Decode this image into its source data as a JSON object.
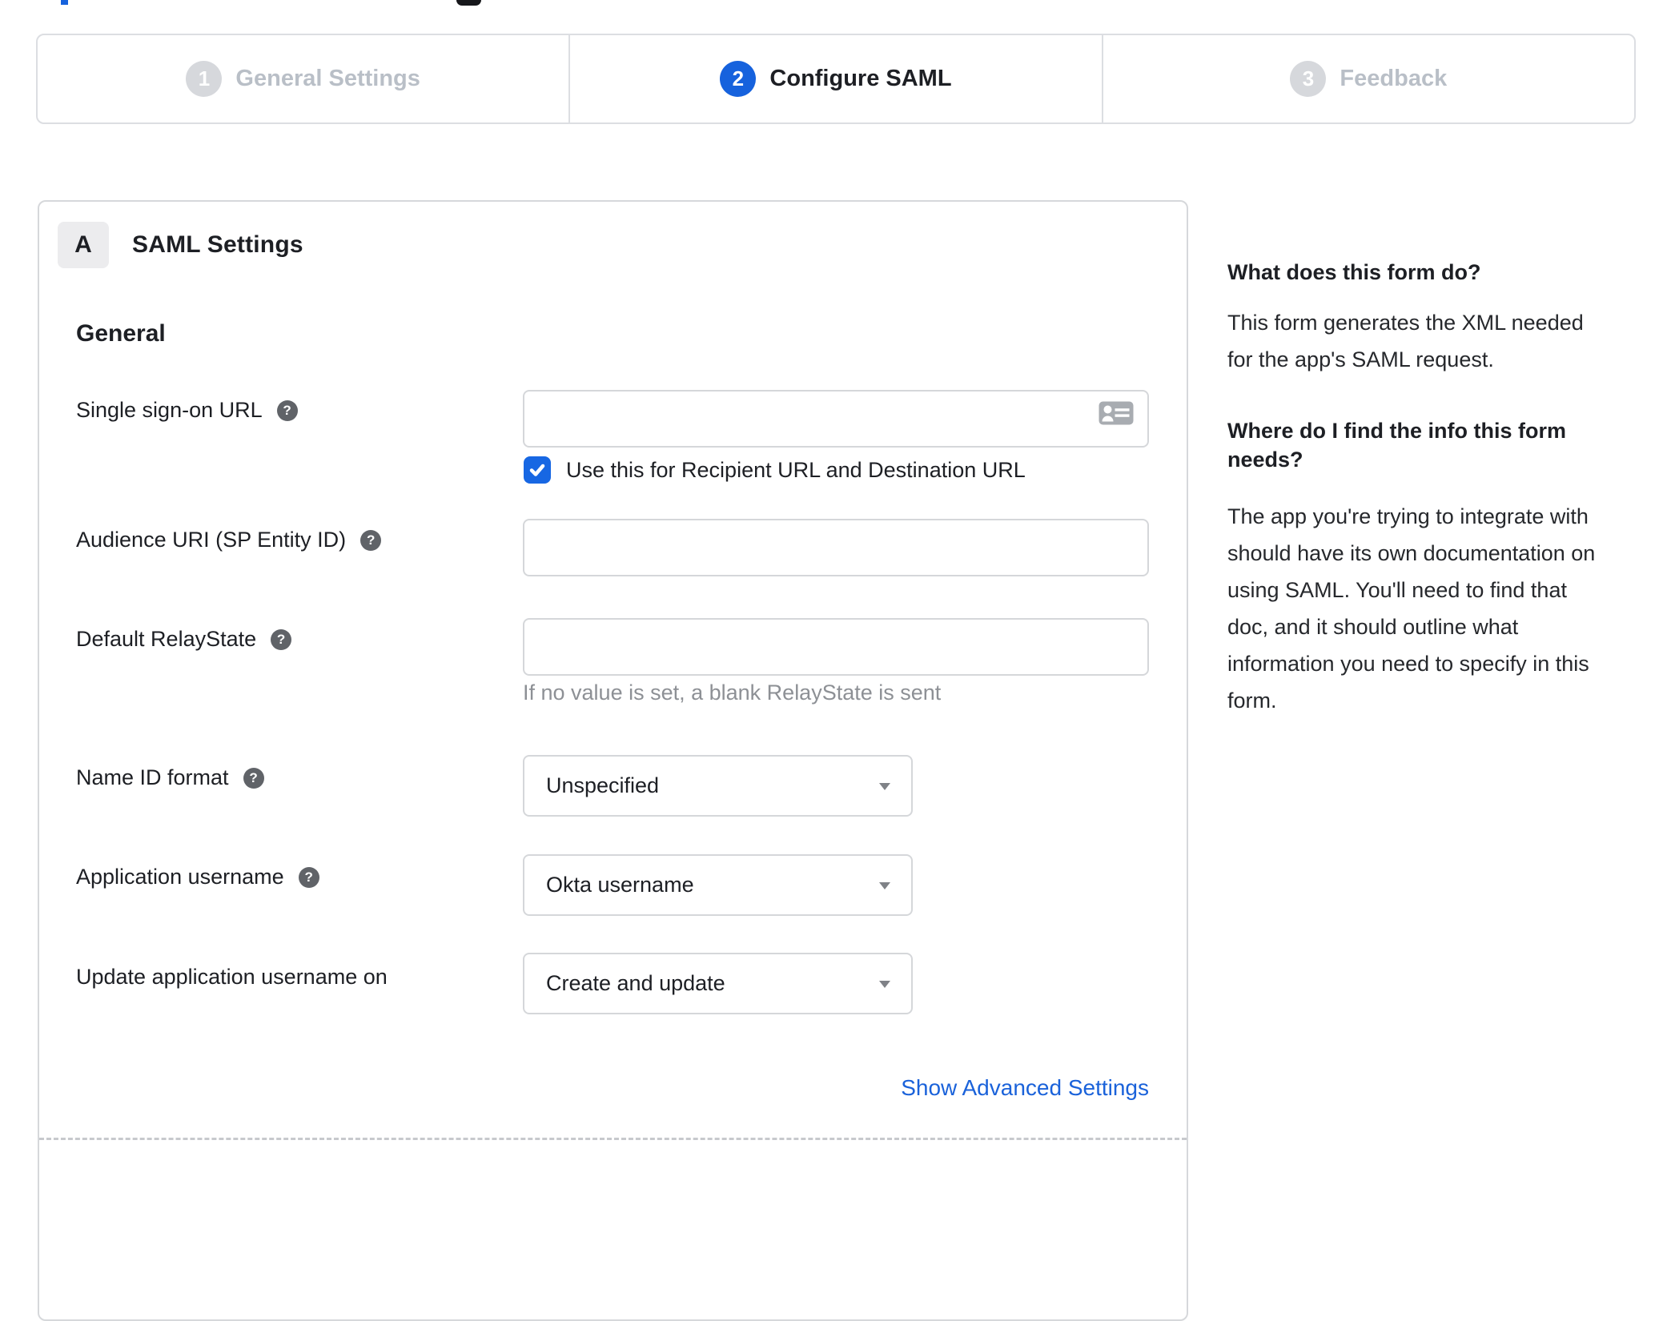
{
  "colors": {
    "accent_blue": "#1662dd",
    "link_blue": "#1a62da"
  },
  "stepper": {
    "steps": [
      {
        "number": "1",
        "label": "General Settings",
        "active": false
      },
      {
        "number": "2",
        "label": "Configure SAML",
        "active": true
      },
      {
        "number": "3",
        "label": "Feedback",
        "active": false
      }
    ]
  },
  "panel": {
    "badge": "A",
    "title": "SAML Settings",
    "section_heading": "General",
    "fields": {
      "sso_url": {
        "label": "Single sign-on URL",
        "value": "",
        "checkbox_label": "Use this for Recipient URL and Destination URL",
        "checkbox_checked": true
      },
      "audience_uri": {
        "label": "Audience URI (SP Entity ID)",
        "value": ""
      },
      "default_relaystate": {
        "label": "Default RelayState",
        "value": "",
        "hint": "If no value is set, a blank RelayState is sent"
      },
      "name_id_format": {
        "label": "Name ID format",
        "value": "Unspecified"
      },
      "app_username": {
        "label": "Application username",
        "value": "Okta username"
      },
      "update_app_username": {
        "label": "Update application username on",
        "value": "Create and update"
      }
    },
    "advanced_link": "Show Advanced Settings"
  },
  "sidebar": {
    "q1": "What does this form do?",
    "a1": "This form generates the XML needed\nfor the app's SAML request.",
    "q2": "Where do I find the info this form\nneeds?",
    "a2": "The app you're trying to integrate with\nshould have its own documentation on\nusing SAML. You'll need to find that\ndoc, and it should outline what\ninformation you need to specify in this\nform."
  }
}
